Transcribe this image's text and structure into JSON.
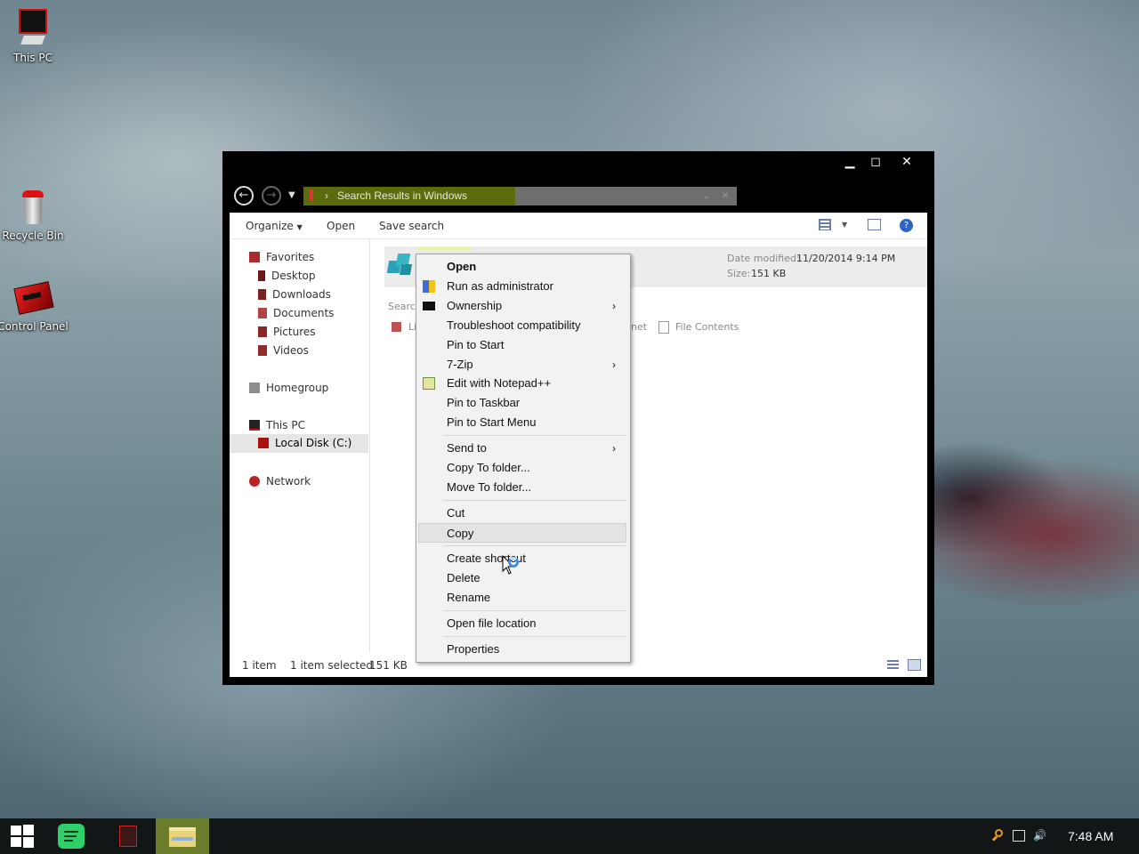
{
  "desktop": {
    "icons": [
      {
        "label": "This PC"
      },
      {
        "label": "Recycle Bin"
      },
      {
        "label": "Control Panel"
      }
    ]
  },
  "window": {
    "controls": {
      "minimize": "▁",
      "maximize": "◻",
      "close": "✕"
    },
    "address": {
      "breadcrumb_sep": "›",
      "location": "Search Results in Windows"
    },
    "ribbon": {
      "organize": "Organize",
      "open": "Open",
      "save_search": "Save search"
    },
    "nav": {
      "favorites": "Favorites",
      "desktop": "Desktop",
      "downloads": "Downloads",
      "documents": "Documents",
      "pictures": "Pictures",
      "videos": "Videos",
      "homegroup": "Homegroup",
      "this_pc": "This PC",
      "local_disk": "Local Disk (C:)",
      "network": "Network"
    },
    "result": {
      "date_label": "Date modified:",
      "date_value": "11/20/2014 9:14 PM",
      "size_label": "Size:",
      "size_value": "151 KB"
    },
    "search_again": {
      "label_fragment": "Searc",
      "lib_fragment": "Li",
      "internet_fragment": "net",
      "file_contents": "File Contents"
    },
    "status": {
      "items": "1 item",
      "selected": "1 item selected",
      "size": "151 KB"
    }
  },
  "context_menu": {
    "items": [
      {
        "label": "Open"
      },
      {
        "label": "Run as administrator"
      },
      {
        "label": "Ownership"
      },
      {
        "label": "Troubleshoot compatibility"
      },
      {
        "label": "Pin to Start"
      },
      {
        "label": "7-Zip"
      },
      {
        "label": "Edit with Notepad++"
      },
      {
        "label": "Pin to Taskbar"
      },
      {
        "label": "Pin to Start Menu"
      },
      {
        "label": "Send to"
      },
      {
        "label": "Copy To folder..."
      },
      {
        "label": "Move To folder..."
      },
      {
        "label": "Cut"
      },
      {
        "label": "Copy"
      },
      {
        "label": "Create shortcut"
      },
      {
        "label": "Delete"
      },
      {
        "label": "Rename"
      },
      {
        "label": "Open file location"
      },
      {
        "label": "Properties"
      }
    ],
    "submenu_arrow": "›"
  },
  "taskbar": {
    "clock": "7:48 AM"
  },
  "colors": {
    "address_highlight": "#5d6b0e",
    "taskbar": "#121616",
    "active_app": "#6b7d2a"
  }
}
